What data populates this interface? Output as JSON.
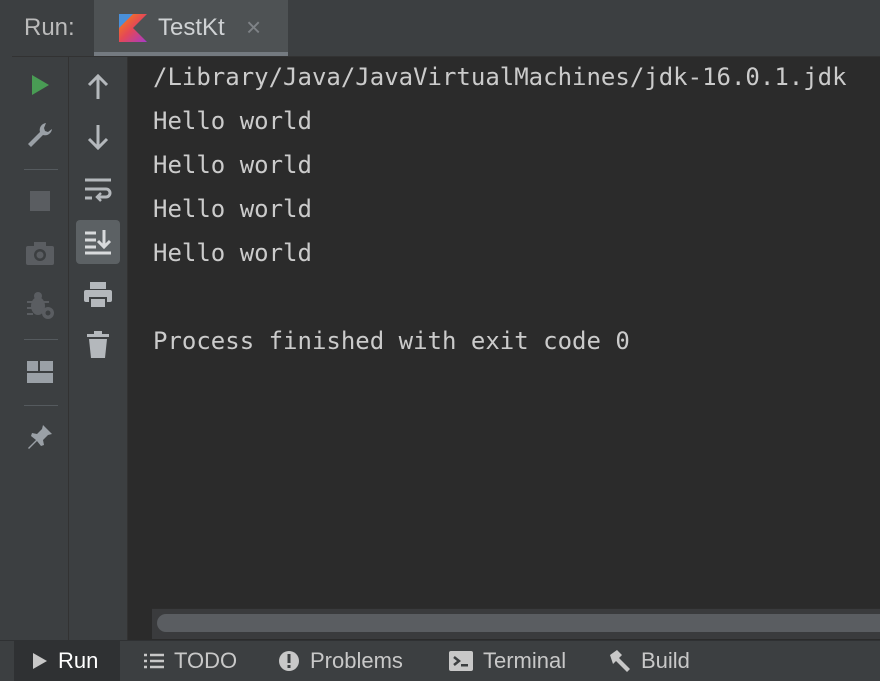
{
  "header": {
    "run_label": "Run:"
  },
  "tab": {
    "title": "TestKt",
    "close": "×"
  },
  "console": {
    "lines": [
      "/Library/Java/JavaVirtualMachines/jdk-16.0.1.jdk",
      "Hello world",
      "Hello world",
      "Hello world",
      "Hello world",
      "",
      "Process finished with exit code 0"
    ]
  },
  "toolbar_left": [
    "rerun-icon",
    "wrench-icon",
    "stop-icon",
    "camera-icon",
    "bug-icon",
    "layout-icon",
    "pin-icon"
  ],
  "toolbar_right": [
    "arrow-up-icon",
    "arrow-down-icon",
    "soft-wrap-icon",
    "scroll-to-end-icon",
    "print-icon",
    "trash-icon"
  ],
  "bottombar": {
    "run": "Run",
    "todo": "TODO",
    "problems": "Problems",
    "terminal": "Terminal",
    "build": "Build"
  },
  "colors": {
    "run_green": "#499c54",
    "kotlin_orange": "#e44857",
    "kotlin_blue": "#4a90d9"
  }
}
